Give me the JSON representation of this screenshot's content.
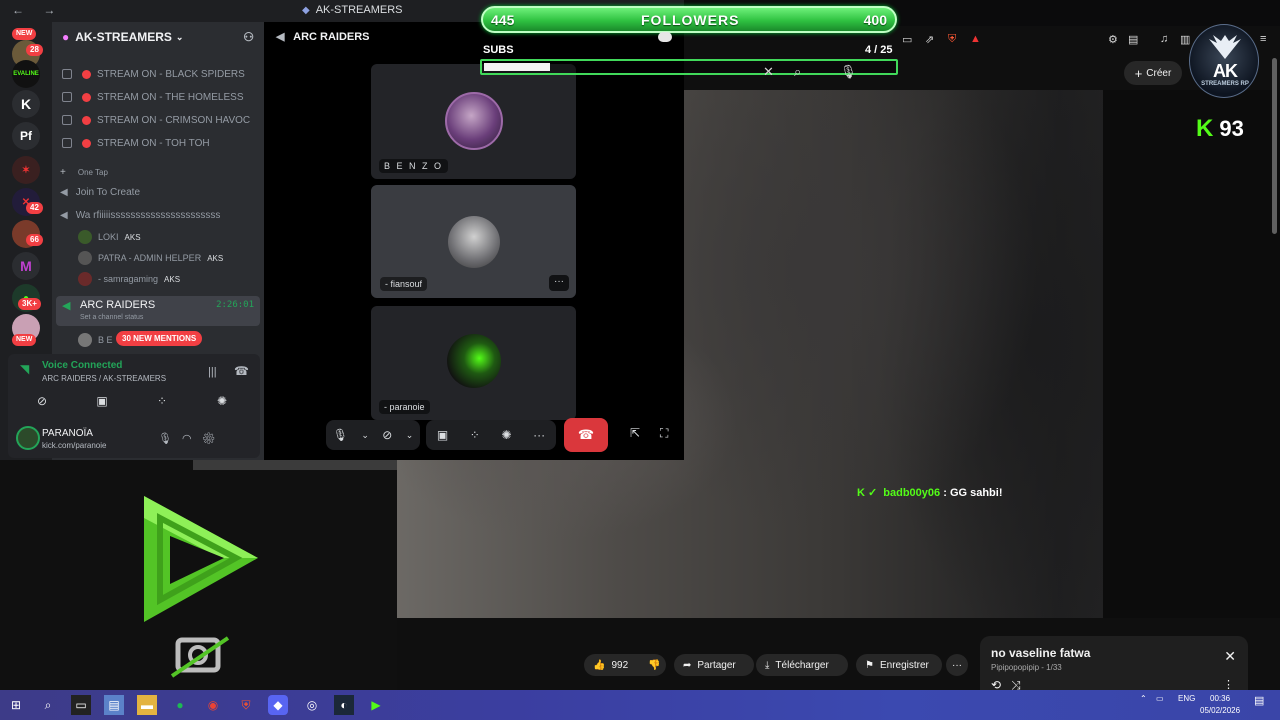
{
  "window": {
    "title": "AK-STREAMERS"
  },
  "servers": {
    "badge_new_top": "NEW",
    "badge_28": "28",
    "badge_42": "42",
    "badge_66": "66",
    "badge_3k": "3K+",
    "badge_new_bottom": "NEW",
    "pf_label": "Pf"
  },
  "server": {
    "name": "AK-STREAMERS",
    "channels": [
      {
        "label": "STREAM ON - BLACK SPIDERS"
      },
      {
        "label": "STREAM ON - THE HOMELESS"
      },
      {
        "label": "STREAM ON - CRIMSON HAVOC"
      },
      {
        "label": "STREAM ON - TOH TOH"
      }
    ],
    "one_tap": "One Tap",
    "join_to_create": "Join To Create",
    "wa_channel": "Wa rfiiiiissssssssssssssssssssss",
    "members": [
      {
        "name": "LOKI",
        "tag": "AKS"
      },
      {
        "name": "PATRA - ADMIN HELPER",
        "tag": "AKS"
      },
      {
        "name": "- samragaming",
        "tag": "AKS"
      }
    ],
    "active_channel": {
      "name": "ARC RAIDERS",
      "time": "2:26:01",
      "status": "Set a channel status"
    },
    "mentions": "30 NEW MENTIONS",
    "b_user": "B E"
  },
  "voice": {
    "status": "Voice Connected",
    "location": "ARC RAIDERS / AK-STREAMERS"
  },
  "user": {
    "name": "PARANOÏA",
    "status": "kick.com/paranoie"
  },
  "stage": {
    "title": "ARC RAIDERS",
    "tiles": [
      {
        "label": "B E N Z O"
      },
      {
        "label": "- fiansouf"
      },
      {
        "label": "- paranoie"
      }
    ]
  },
  "overlay": {
    "followers_current": "445",
    "followers_label": "FOLLOWERS",
    "followers_goal": "400",
    "subs_label": "SUBS",
    "subs_count": "4 / 25",
    "subs_progress": 0.16
  },
  "youtube": {
    "create_label": "Créer",
    "likes": "992",
    "share": "Partager",
    "download": "Télécharger",
    "save": "Enregistrer",
    "mini_title": "no vaseline fatwa",
    "mini_sub": "Pipipopopipip - 1/33"
  },
  "ak_logo": {
    "text": "AK",
    "sub": "STREAMERS RP"
  },
  "kick": {
    "count": "93"
  },
  "chat": {
    "user": "badb00y06",
    "message": ": GG sahbi!"
  },
  "taskbar": {
    "lang": "ENG",
    "time": "00:36",
    "date": "05/02/2026"
  },
  "colors": {
    "accent_green": "#53fc18",
    "discord_red": "#f23f43",
    "discord_green": "#23a559"
  }
}
